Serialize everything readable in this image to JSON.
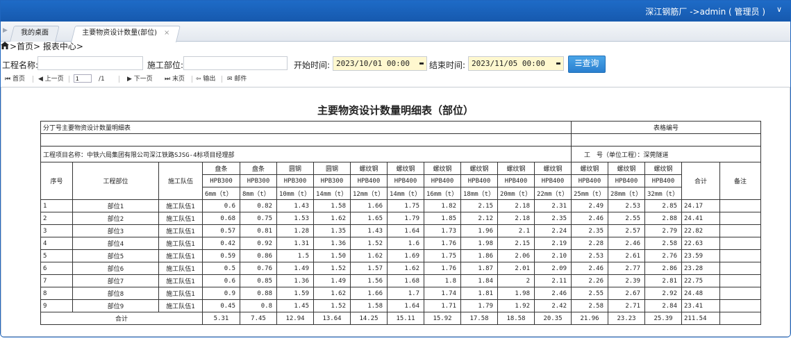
{
  "header": {
    "user": "深江钢筋厂  ->admin ( 管理员 )",
    "caret": "∨"
  },
  "tabs": [
    {
      "label": "我的桌面"
    },
    {
      "label": "主要物资设计数量(部位)",
      "close": "×"
    }
  ],
  "breadcrumb": ">首页> 报表中心>",
  "filters": {
    "project_label": "工程名称:",
    "project_value": "",
    "part_label": "施工部位:",
    "part_value": "",
    "start_label": "开始时间:",
    "start_value": "2023/10/01 00:00",
    "end_label": "结束时间:",
    "end_value": "2023/11/05 00:00",
    "query_button": "查询"
  },
  "pager": {
    "first": "首页",
    "prev": "上一页",
    "page": "1",
    "total": "/1",
    "next": "下一页",
    "last": "末页",
    "export": "输出",
    "mail": "邮件"
  },
  "report": {
    "title": "主要物资设计数量明细表（部位）",
    "sub_left": "分丁号主要物资设计数量明细表",
    "table_code_label": "表格编号",
    "project_name": "工程项目名称：中铁六局集团有限公司深江铁路SJSG-4标项目经理部",
    "unit_label": "工　号（单位工程）：深莞隧道",
    "col_seq": "序号",
    "col_part": "工程部位",
    "col_team": "施工队伍",
    "col_total": "合计",
    "col_remark": "备注",
    "materials": [
      {
        "name": "盘条",
        "grade": "HPB300",
        "spec": "6mm（t）"
      },
      {
        "name": "盘条",
        "grade": "HPB300",
        "spec": "8mm（t）"
      },
      {
        "name": "圆钢",
        "grade": "HPB300",
        "spec": "10mm（t）"
      },
      {
        "name": "圆钢",
        "grade": "HPB300",
        "spec": "14mm（t）"
      },
      {
        "name": "螺纹钢",
        "grade": "HPB400",
        "spec": "12mm（t）"
      },
      {
        "name": "螺纹钢",
        "grade": "HPB400",
        "spec": "14mm（t）"
      },
      {
        "name": "螺纹钢",
        "grade": "HPB400",
        "spec": "16mm（t）"
      },
      {
        "name": "螺纹钢",
        "grade": "HPB400",
        "spec": "18mm（t）"
      },
      {
        "name": "螺纹钢",
        "grade": "HPB400",
        "spec": "20mm（t）"
      },
      {
        "name": "螺纹钢",
        "grade": "HPB400",
        "spec": "22mm（t）"
      },
      {
        "name": "螺纹钢",
        "grade": "HPB400",
        "spec": "25mm（t）"
      },
      {
        "name": "螺纹钢",
        "grade": "HPB400",
        "spec": "28mm（t）"
      },
      {
        "name": "螺纹钢",
        "grade": "HPB400",
        "spec": "32mm（t）"
      }
    ],
    "rows": [
      {
        "seq": "1",
        "part": "部位1",
        "team": "施工队伍1",
        "values": [
          "0.6",
          "0.82",
          "1.43",
          "1.58",
          "1.66",
          "1.75",
          "1.82",
          "2.15",
          "2.18",
          "2.31",
          "2.49",
          "2.53",
          "2.85"
        ],
        "total": "24.17"
      },
      {
        "seq": "2",
        "part": "部位2",
        "team": "施工队伍1",
        "values": [
          "0.68",
          "0.75",
          "1.53",
          "1.62",
          "1.65",
          "1.79",
          "1.85",
          "2.12",
          "2.18",
          "2.35",
          "2.46",
          "2.55",
          "2.88"
        ],
        "total": "24.41"
      },
      {
        "seq": "3",
        "part": "部位3",
        "team": "施工队伍1",
        "values": [
          "0.57",
          "0.81",
          "1.28",
          "1.35",
          "1.43",
          "1.64",
          "1.73",
          "1.96",
          "2.1",
          "2.24",
          "2.35",
          "2.57",
          "2.79"
        ],
        "total": "22.82"
      },
      {
        "seq": "4",
        "part": "部位4",
        "team": "施工队伍1",
        "values": [
          "0.42",
          "0.92",
          "1.31",
          "1.36",
          "1.52",
          "1.6",
          "1.76",
          "1.98",
          "2.15",
          "2.19",
          "2.28",
          "2.46",
          "2.58"
        ],
        "total": "22.63"
      },
      {
        "seq": "5",
        "part": "部位5",
        "team": "施工队伍1",
        "values": [
          "0.59",
          "0.86",
          "1.5",
          "1.50",
          "1.62",
          "1.69",
          "1.75",
          "1.86",
          "2.06",
          "2.10",
          "2.53",
          "2.61",
          "2.76"
        ],
        "total": "23.59"
      },
      {
        "seq": "6",
        "part": "部位6",
        "team": "施工队伍1",
        "values": [
          "0.5",
          "0.76",
          "1.49",
          "1.52",
          "1.57",
          "1.62",
          "1.76",
          "1.87",
          "2.01",
          "2.09",
          "2.46",
          "2.77",
          "2.86"
        ],
        "total": "23.28"
      },
      {
        "seq": "7",
        "part": "部位7",
        "team": "施工队伍1",
        "values": [
          "0.6",
          "0.85",
          "1.36",
          "1.49",
          "1.56",
          "1.68",
          "1.8",
          "1.84",
          "2",
          "2.11",
          "2.26",
          "2.39",
          "2.81"
        ],
        "total": "22.75"
      },
      {
        "seq": "8",
        "part": "部位8",
        "team": "施工队伍1",
        "values": [
          "0.9",
          "0.88",
          "1.59",
          "1.62",
          "1.66",
          "1.7",
          "1.74",
          "1.81",
          "1.98",
          "2.46",
          "2.55",
          "2.67",
          "2.92"
        ],
        "total": "24.48"
      },
      {
        "seq": "9",
        "part": "部位9",
        "team": "施工队伍1",
        "values": [
          "0.45",
          "0.8",
          "1.45",
          "1.52",
          "1.58",
          "1.64",
          "1.71",
          "1.79",
          "1.92",
          "2.42",
          "2.58",
          "2.71",
          "2.84"
        ],
        "total": "23.41"
      }
    ],
    "sum_label": "合计",
    "sums": [
      "5.31",
      "7.45",
      "12.94",
      "13.64",
      "14.25",
      "15.11",
      "15.92",
      "17.58",
      "18.58",
      "20.35",
      "21.96",
      "23.23",
      "25.39"
    ],
    "sum_total": "211.54"
  },
  "colors": {
    "topbar": "#1a62bb",
    "date_bg": "#fff8cf",
    "query_btn": "#3a92dc"
  }
}
